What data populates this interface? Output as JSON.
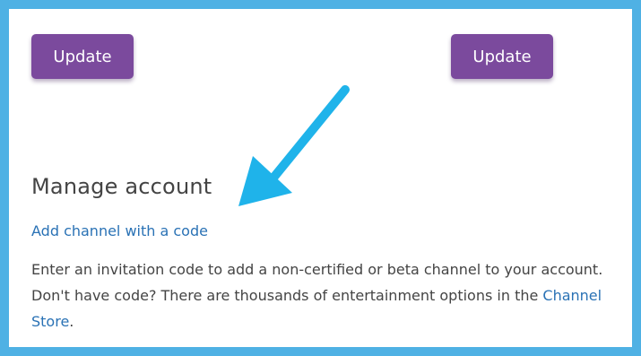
{
  "buttons": {
    "update_left": "Update",
    "update_right": "Update"
  },
  "manage_account": {
    "title": "Manage account",
    "add_channel_link": "Add channel with a code",
    "description_before": "Enter an invitation code to add a non-certified or beta channel to your account. Don't have code? There are thousands of entertainment options in the ",
    "channel_store_link": "Channel Store",
    "description_after": "."
  },
  "colors": {
    "frame_border": "#4fb1e4",
    "button_purple": "#7b4a9d",
    "link_blue": "#2a72b5",
    "annotation_arrow": "#1fb3ea"
  },
  "icons": {
    "annotation": "annotation-arrow-icon"
  }
}
